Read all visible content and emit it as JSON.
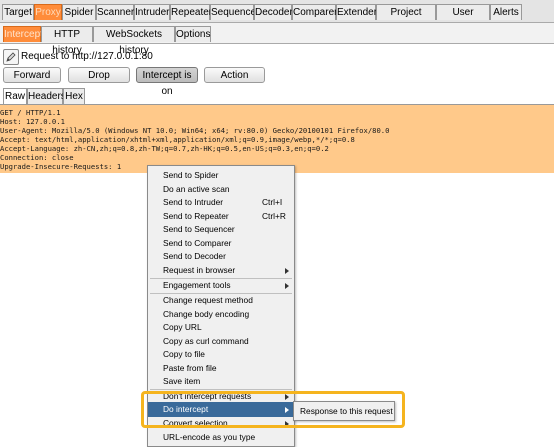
{
  "top_tabs": [
    "Target",
    "Proxy",
    "Spider",
    "Scanner",
    "Intruder",
    "Repeater",
    "Sequencer",
    "Decoder",
    "Comparer",
    "Extender",
    "Project options",
    "User options",
    "Alerts"
  ],
  "sub_tabs": [
    "Intercept",
    "HTTP history",
    "WebSockets history",
    "Options"
  ],
  "request_label": "Request to http://127.0.0.1:80",
  "buttons": {
    "forward": "Forward",
    "drop": "Drop",
    "intercept": "Intercept is on",
    "action": "Action"
  },
  "editor_tabs": [
    "Raw",
    "Headers",
    "Hex"
  ],
  "request_lines": [
    "GET / HTTP/1.1",
    "Host: 127.0.0.1",
    "User-Agent: Mozilla/5.0 (Windows NT 10.0; Win64; x64; rv:80.0) Gecko/20100101 Firefox/80.0",
    "Accept: text/html,application/xhtml+xml,application/xml;q=0.9,image/webp,*/*;q=0.8",
    "Accept-Language: zh-CN,zh;q=0.8,zh-TW;q=0.7,zh-HK;q=0.5,en-US;q=0.3,en;q=0.2",
    "Connection: close",
    "Upgrade-Insecure-Requests: 1"
  ],
  "context_menu": [
    {
      "label": "Send to Spider"
    },
    {
      "label": "Do an active scan"
    },
    {
      "label": "Send to Intruder",
      "shortcut": "Ctrl+I"
    },
    {
      "label": "Send to Repeater",
      "shortcut": "Ctrl+R"
    },
    {
      "label": "Send to Sequencer"
    },
    {
      "label": "Send to Comparer"
    },
    {
      "label": "Send to Decoder"
    },
    {
      "label": "Request in browser",
      "submenu": true
    },
    {
      "label": "Engagement tools",
      "submenu": true
    },
    {
      "label": "Change request method"
    },
    {
      "label": "Change body encoding"
    },
    {
      "label": "Copy URL"
    },
    {
      "label": "Copy as curl command"
    },
    {
      "label": "Copy to file"
    },
    {
      "label": "Paste from file"
    },
    {
      "label": "Save item"
    },
    {
      "label": "Don't intercept requests",
      "submenu": true
    },
    {
      "label": "Do intercept",
      "submenu": true,
      "highlighted": true
    },
    {
      "label": "Convert selection",
      "submenu": true
    },
    {
      "label": "URL-encode as you type"
    }
  ],
  "submenu_item": "Response to this request",
  "colors": {
    "accent_orange": "#ff8c3a",
    "editor_background": "#ffc98a",
    "menu_highlight": "#3a6a9a",
    "callout_border": "#f5b41e"
  },
  "icons": {
    "request_icon": "pencil-icon",
    "submenu_indicator": "chevron-right-icon"
  }
}
